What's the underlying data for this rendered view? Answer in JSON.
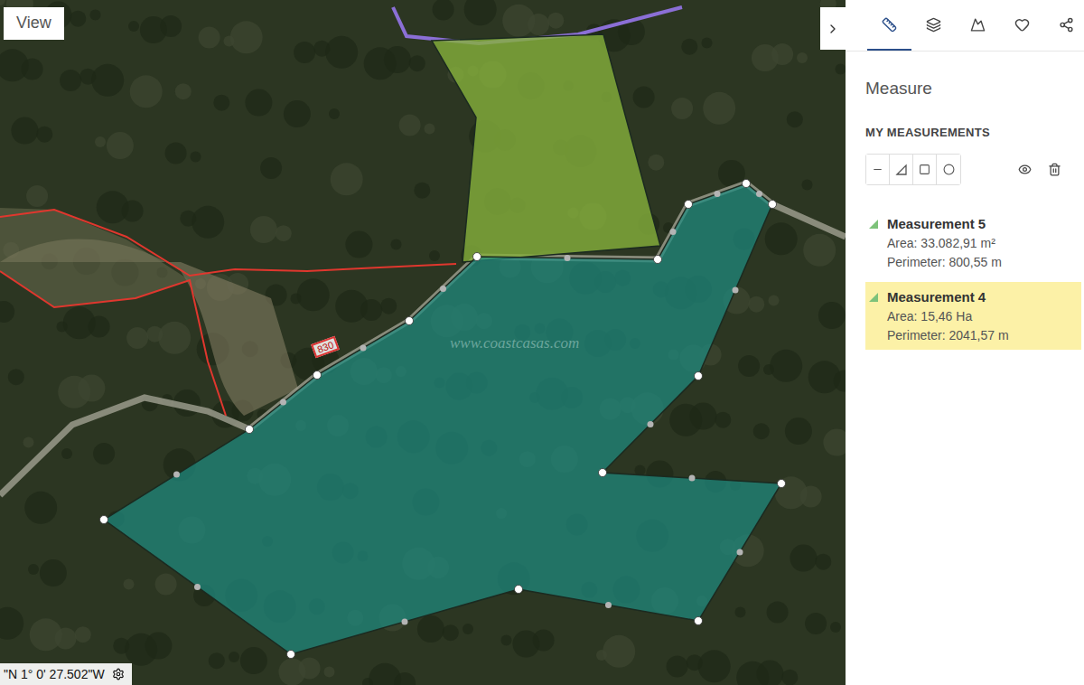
{
  "map": {
    "view_button": "View",
    "coordinates": "\"N 1° 0' 27.502\"W",
    "parcel_label": "830",
    "watermark": "www.coastcasas.com"
  },
  "panel": {
    "tabs": [
      {
        "kind": "measure",
        "selected": true
      },
      {
        "kind": "layers",
        "selected": false
      },
      {
        "kind": "profile",
        "selected": false
      },
      {
        "kind": "favorites",
        "selected": false
      },
      {
        "kind": "share",
        "selected": false
      }
    ],
    "title": "Measure",
    "section": "MY MEASUREMENTS",
    "tools": [
      {
        "kind": "line",
        "selected": false
      },
      {
        "kind": "polygon",
        "selected": false
      },
      {
        "kind": "rectangle",
        "selected": false
      },
      {
        "kind": "circle",
        "selected": false
      }
    ],
    "measurements": [
      {
        "name": "Measurement 5",
        "area": "Area: 33.082,91 m²",
        "perimeter": "Perimeter: 800,55 m",
        "selected": false,
        "color": "#86b03c"
      },
      {
        "name": "Measurement 4",
        "area": "Area: 15,46 Ha",
        "perimeter": "Perimeter: 2041,57 m",
        "selected": true,
        "color": "#1f8a80"
      }
    ]
  }
}
